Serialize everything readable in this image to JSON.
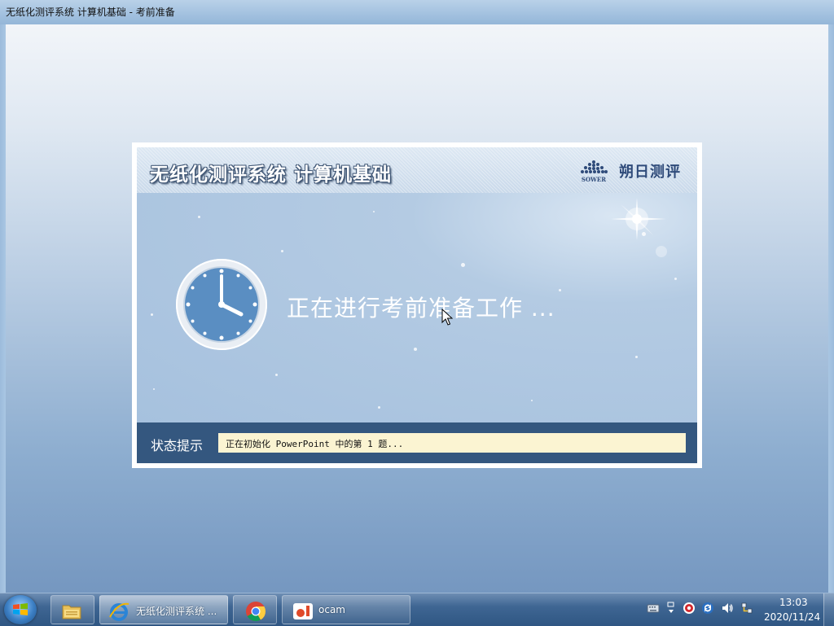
{
  "window": {
    "title": "无纸化测评系统 计算机基础 - 考前准备"
  },
  "splash": {
    "title": "无纸化测评系统 计算机基础",
    "brand_logo_text": "SOWER",
    "brand_name": "朔日测评",
    "message": "正在进行考前准备工作 ...",
    "status_label": "状态提示",
    "status_value": "正在初始化 PowerPoint 中的第 1 题..."
  },
  "taskbar": {
    "start_icon": "windows-logo-icon",
    "items": [
      {
        "name": "file-explorer",
        "label": "",
        "icon": "folder-icon"
      },
      {
        "name": "internet-explorer",
        "label": "无纸化测评系统 ...",
        "icon": "ie-icon"
      },
      {
        "name": "chrome",
        "label": "",
        "icon": "chrome-icon"
      },
      {
        "name": "ocam",
        "label": "ocam",
        "icon": "ocam-icon"
      }
    ],
    "tray_icons": [
      "keyboard-icon",
      "network-arrows-icon",
      "record-icon",
      "sync-icon",
      "volume-icon",
      "network-icon"
    ],
    "time": "13:03",
    "date": "2020/11/24"
  },
  "colors": {
    "status_bar": "#34577f",
    "status_field": "#fbf4d2",
    "brand": "#2f4b7a"
  }
}
